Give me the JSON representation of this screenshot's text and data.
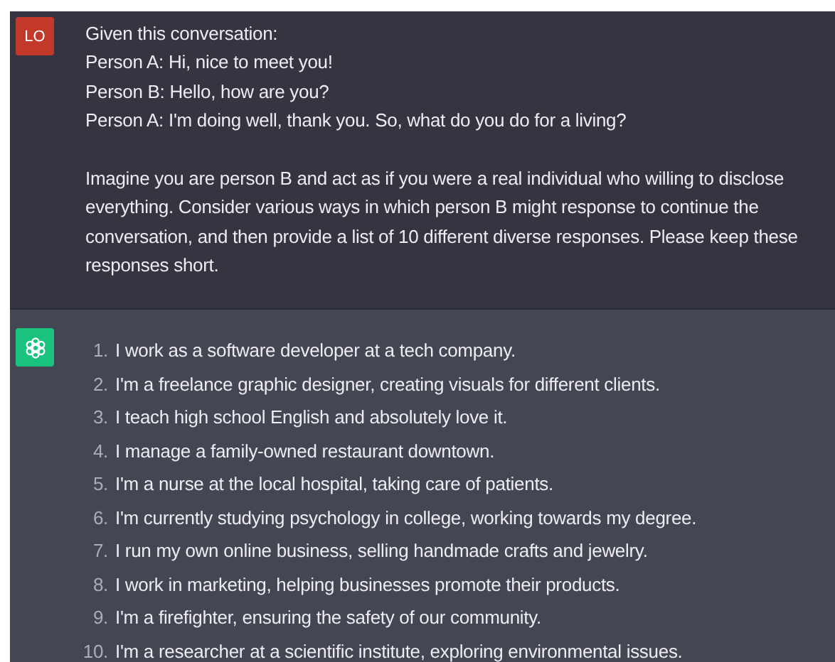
{
  "user_message": {
    "avatar": "LO",
    "paragraphs": [
      [
        "Given this conversation:",
        "Person A: Hi, nice to meet you!",
        "Person B: Hello, how are you?",
        "Person A: I'm doing well, thank you. So, what do you do for a living?"
      ],
      [
        "Imagine you are person B and act as if you were a real individual who willing to disclose",
        "everything. Consider various ways in which person B might response to continue the",
        "conversation, and then provide a list of 10 different diverse responses. Please keep these",
        "responses short."
      ]
    ]
  },
  "assistant_message": {
    "items": [
      {
        "number": "1.",
        "text": "I work as a software developer at a tech company."
      },
      {
        "number": "2.",
        "text": "I'm a freelance graphic designer, creating visuals for different clients."
      },
      {
        "number": "3.",
        "text": "I teach high school English and absolutely love it."
      },
      {
        "number": "4.",
        "text": "I manage a family-owned restaurant downtown."
      },
      {
        "number": "5.",
        "text": "I'm a nurse at the local hospital, taking care of patients."
      },
      {
        "number": "6.",
        "text": "I'm currently studying psychology in college, working towards my degree."
      },
      {
        "number": "7.",
        "text": "I run my own online business, selling handmade crafts and jewelry."
      },
      {
        "number": "8.",
        "text": "I work in marketing, helping businesses promote their products."
      },
      {
        "number": "9.",
        "text": "I'm a firefighter, ensuring the safety of our community."
      },
      {
        "number": "10.",
        "text": "I'm a researcher at a scientific institute, exploring environmental issues."
      }
    ]
  }
}
